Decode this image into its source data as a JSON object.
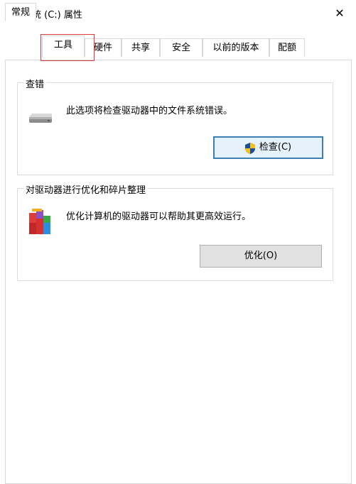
{
  "window": {
    "title": "系统 (C:) 属性",
    "close_glyph": "✕"
  },
  "tabs": [
    {
      "label": "常规",
      "active": false
    },
    {
      "label": "工具",
      "active": true
    },
    {
      "label": "硬件",
      "active": false
    },
    {
      "label": "共享",
      "active": false
    },
    {
      "label": "安全",
      "active": false
    },
    {
      "label": "以前的版本",
      "active": false
    },
    {
      "label": "配额",
      "active": false
    }
  ],
  "check_group": {
    "title": "查错",
    "description": "此选项将检查驱动器中的文件系统错误。",
    "button_label": "检查(C)"
  },
  "optimize_group": {
    "title": "对驱动器进行优化和碎片整理",
    "description": "优化计算机的驱动器可以帮助其更高效运行。",
    "button_label": "优化(O)"
  },
  "icons": {
    "title": "drive-icon",
    "check_group": "drive-icon",
    "check_button": "uac-shield-icon",
    "optimize_group": "defrag-icon"
  },
  "colors": {
    "tab_highlight": "#e03a3a",
    "primary_button_border": "#3c7fb1"
  }
}
